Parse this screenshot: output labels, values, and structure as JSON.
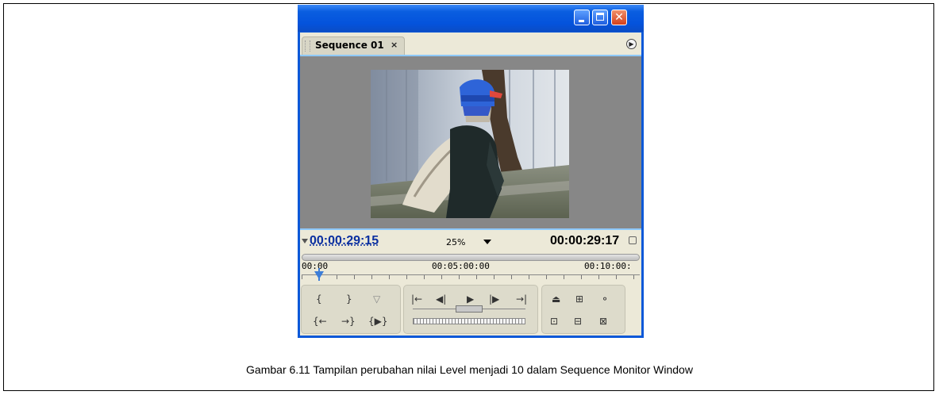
{
  "window": {
    "tab_label": "Sequence 01",
    "tab_close": "×"
  },
  "timecode": {
    "current": "00:00:29:15",
    "duration": "00:00:29:17",
    "zoom": "25%"
  },
  "ruler": {
    "labels": [
      "00:00",
      "00:05:00:00",
      "00:10:00:"
    ]
  },
  "controls": {
    "left_group": [
      "mark-in-icon",
      "mark-out-icon",
      "set-marker-icon",
      "goto-in-icon",
      "goto-out-icon",
      "play-in-to-out-icon"
    ],
    "transport": [
      "step-to-start-icon",
      "step-back-icon",
      "play-icon",
      "step-forward-icon",
      "step-to-end-icon"
    ],
    "right_group": [
      "lift-icon",
      "extract-icon",
      "output-icon",
      "trim-icon",
      "overlay-icon",
      "multi-camera-icon"
    ]
  },
  "colors": {
    "titlebar": "#0a58d8",
    "timecode_blue": "#0a2fa0",
    "monitor_bg": "#878787",
    "panel_bg": "#ece9d8"
  },
  "caption": "Gambar 6.11 Tampilan perubahan nilai Level menjadi 10 dalam Sequence Monitor Window"
}
